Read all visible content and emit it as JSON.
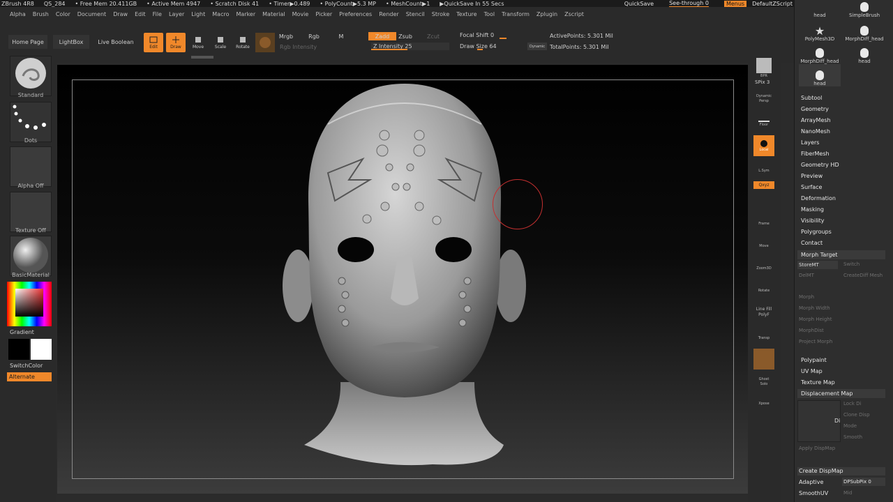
{
  "topbar": {
    "app": "ZBrush 4R8",
    "qs": "QS_284",
    "free_mem": "• Free Mem 20.411GB",
    "active_mem": "• Active Mem 4947",
    "scratch": "• Scratch Disk 41",
    "timer": "• Timer▶0.489",
    "polycount": "• PolyCount▶5.3 MP",
    "meshcount": "• MeshCount▶1",
    "quicksave": "▶QuickSave In 55 Secs"
  },
  "top_right": {
    "quicksave_btn": "QuickSave",
    "seethrough": "See-through  0",
    "menus": "Menus",
    "script": "DefaultZScript"
  },
  "menu": [
    "Alpha",
    "Brush",
    "Color",
    "Document",
    "Draw",
    "Edit",
    "File",
    "Layer",
    "Light",
    "Macro",
    "Marker",
    "Material",
    "Movie",
    "Picker",
    "Preferences",
    "Render",
    "Stencil",
    "Stroke",
    "Texture",
    "Tool",
    "Transform",
    "Zplugin",
    "Zscript"
  ],
  "toolbar": {
    "home": "Home Page",
    "lightbox": "LightBox",
    "liveboolean": "Live Boolean",
    "edit": "Edit",
    "draw": "Draw",
    "move": "Move",
    "scale": "Scale",
    "rotate": "Rotate",
    "mrgb": "Mrgb",
    "rgb": "Rgb",
    "m": "M",
    "rgb_intensity": "Rgb Intensity",
    "zadd": "Zadd",
    "zsub": "Zsub",
    "zcut": "Zcut",
    "z_intensity_label": "Z Intensity",
    "z_intensity": "25",
    "focal_label": "Focal Shift",
    "focal": "0",
    "drawsize_label": "Draw Size",
    "drawsize": "64",
    "dynamic": "Dynamic",
    "active_points": "ActivePoints: 5.301 Mil",
    "total_points": "TotalPoints: 5.301 Mil"
  },
  "left": {
    "brush": "Standard",
    "stroke": "Dots",
    "alpha": "Alpha Off",
    "texture": "Texture Off",
    "material": "BasicMaterial",
    "gradient": "Gradient",
    "switchcolor": "SwitchColor",
    "alternate": "Alternate"
  },
  "right_tools": {
    "bpr": "BPR",
    "spix_label": "SPix",
    "spix": "3",
    "dynamic": "Dynamic",
    "persp": "Persp",
    "floor": "Floor",
    "local": "Local",
    "lsym": "L.Sym",
    "xyz": "Qxyz",
    "frame": "Frame",
    "move": "Move",
    "zoom3d": "Zoom3D",
    "rotate": "Rotate",
    "linefill": "Line Fill",
    "polyf": "PolyF",
    "transp": "Transp",
    "ghost": "Ghost",
    "solo": "Solo",
    "xpose": "Xpose"
  },
  "subtools": [
    "head",
    "SimpleBrush",
    "PolyMesh3D",
    "MorphDiff_head",
    "MorphDiff_head",
    "head",
    "head"
  ],
  "panel": [
    "Subtool",
    "Geometry",
    "ArrayMesh",
    "NanoMesh",
    "Layers",
    "FiberMesh",
    "Geometry HD",
    "Preview",
    "Surface",
    "Deformation",
    "Masking",
    "Visibility",
    "Polygroups",
    "Contact"
  ],
  "morph": {
    "title": "Morph Target",
    "storemt": "StoreMT",
    "switch": "Switch",
    "delmt": "DelMT",
    "create_diff": "CreateDiff Mesh",
    "morph": "Morph",
    "morph_width": "Morph Width",
    "morph_height": "Morph Height",
    "morph_dist": "MorphDist",
    "morph_brush": "Project Morph"
  },
  "panel2": [
    "Polypaint",
    "UV Map",
    "Texture Map"
  ],
  "disp": {
    "title": "Displacement Map",
    "disp_label": "Di",
    "lock": "Lock Di",
    "create_disp": "Clone Disp",
    "mode": "Mode",
    "smooth": "Smooth",
    "apply": "Apply DispMap",
    "create": "Create DispMap",
    "adaptive": "Adaptive",
    "dpsubpix_label": "DPSubPix",
    "dpsubpix": "0",
    "smoothuv": "SmoothUV",
    "mid": "Mid"
  }
}
